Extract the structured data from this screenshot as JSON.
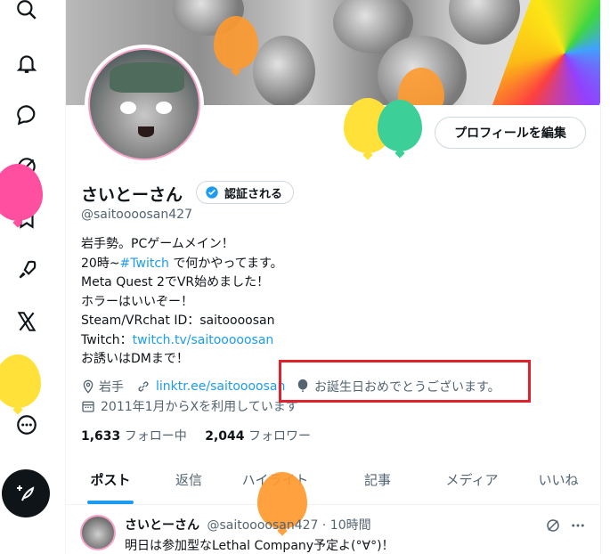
{
  "nav": {
    "items": [
      "search-icon",
      "notifications-icon",
      "messages-icon",
      "grok-icon",
      "bookmarks-icon",
      "communities-icon",
      "x-premium-icon",
      "profile-icon",
      "more-icon"
    ],
    "compose_icon": "feather-plus-icon"
  },
  "profile": {
    "edit_button": "プロフィールを編集",
    "name": "さいとーさん",
    "verify_label": "認証される",
    "handle": "@saitoooosan427",
    "bio_lines": [
      {
        "pre": "岩手勢。PCゲームメイン！",
        "link": "",
        "post": ""
      },
      {
        "pre": "20時~",
        "link": "#Twitch",
        "post": " で何かやってます。"
      },
      {
        "pre": "Meta Quest 2でVR始めました！",
        "link": "",
        "post": ""
      },
      {
        "pre": "ホラーはいいぞー！",
        "link": "",
        "post": ""
      },
      {
        "pre": "Steam/VRchat ID：saitoooosan",
        "link": "",
        "post": ""
      },
      {
        "pre": "Twitch：",
        "link": "twitch.tv/saitooooosan",
        "post": ""
      },
      {
        "pre": "お誘いはDMまで！",
        "link": "",
        "post": ""
      }
    ],
    "location": "岩手",
    "website": "linktr.ee/saitoooosan",
    "birthday_message": "お誕生日おめでとうございます。",
    "joined": "2011年1月からXを利用しています",
    "following_count": "1,633",
    "following_label": "フォロー中",
    "followers_count": "2,044",
    "followers_label": "フォロワー"
  },
  "tabs": [
    "ポスト",
    "返信",
    "ハイライト",
    "記事",
    "メディア",
    "いいね"
  ],
  "active_tab": "ポスト",
  "post": {
    "name": "さいとーさん",
    "handle": "@saitoooosan427",
    "time": "· 10時間",
    "text": "明日は参加型なLethal Company予定よ(°∀°)！"
  },
  "colors": {
    "accent": "#1d9bf0",
    "verified": "#1d9bf0",
    "highlight_box": "#e0222c",
    "balloon_pink": "#ff4fa0",
    "balloon_yellow": "#ffe13a",
    "balloon_orange": "#ff9a2e",
    "balloon_green": "#3dcf98"
  }
}
